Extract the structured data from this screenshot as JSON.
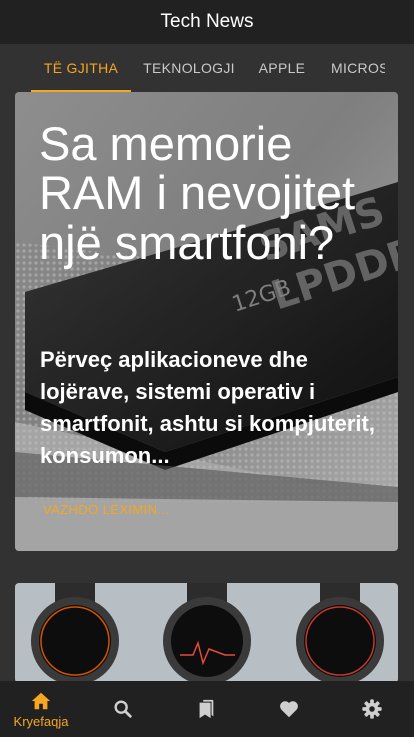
{
  "header": {
    "title": "Tech News"
  },
  "tabs": [
    {
      "label": "TË GJITHA",
      "active": true
    },
    {
      "label": "TEKNOLOGJI",
      "active": false
    },
    {
      "label": "APPLE",
      "active": false
    },
    {
      "label": "MICROS",
      "active": false
    }
  ],
  "articles": [
    {
      "title": "Sa memorie RAM i nevojitet një smartfoni?",
      "excerpt": "Përveç aplikacioneve dhe lojërave, sistemi operativ i smartfonit, ashtu si kompjuterit, konsumon...",
      "read_more": "VAZHDO LEXIMIN..."
    }
  ],
  "bottom_nav": [
    {
      "icon": "home-icon",
      "label": "Kryefaqja",
      "active": true
    },
    {
      "icon": "search-icon",
      "label": "",
      "active": false
    },
    {
      "icon": "bookmarks-icon",
      "label": "",
      "active": false
    },
    {
      "icon": "heart-icon",
      "label": "",
      "active": false
    },
    {
      "icon": "gear-icon",
      "label": "",
      "active": false
    }
  ],
  "colors": {
    "accent": "#f5a623",
    "header_bg": "#212121",
    "page_bg": "#323232"
  }
}
